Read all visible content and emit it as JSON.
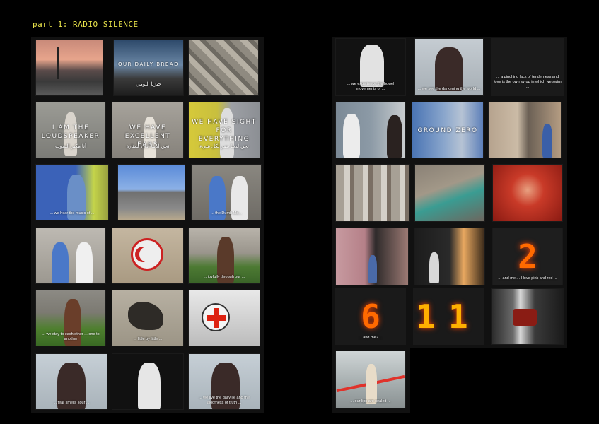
{
  "heading": "part 1: RADIO SILENCE",
  "left_frames": {
    "r1c2_title": "OUR DAILY BREAD",
    "r1c2_arabic": "خبزنا اليومي",
    "r2c1_title": "I AM THE LOUDSPEAKER",
    "r2c1_arabic": "أنا مكبر الصوت",
    "r2c2_title": "WE HAVE EXCELLENT EARS",
    "r2c2_arabic": "نحن لدينا آذان ممتازة",
    "r2c3_title": "WE HAVE SIGHT FOR EVERYTHING",
    "r2c3_arabic": "نحن لدينا بصر لكل شيء",
    "r3c1_sub": "... we hear the music of ...",
    "r3c3_sub": "... the Dumb Mo...",
    "r4c3_sub": "... joyfully through our ...",
    "r5c1_sub": "... we stay to each other ... one to another",
    "r5c2_sub": "... little by little ...",
    "r6c1_sub": "... fear smells sour ...",
    "r6c3_sub": "... we live the daily lie and the aloofness of truth ..."
  },
  "right_frames": {
    "r1c1_sub": "... we experience the bowel movements of ...",
    "r1c2_sub": "... we see the darkening the world ...",
    "r1c3_sub": "... a pinching lack of tenderness and love is the own syrup in which we swim ...",
    "r2c2_title": "GROUND ZERO",
    "r4c3_digit": "2",
    "r4c3_sub": "... and me ... I love pink and red ...",
    "r5c1_digit": "6",
    "r5c1_sub": "... and me? ...",
    "r5c2_digit": "11",
    "r6c1_sub": "... our lips are sealed ..."
  },
  "colors": {
    "heading": "#e8e24a",
    "digit": "#ff6a00"
  }
}
